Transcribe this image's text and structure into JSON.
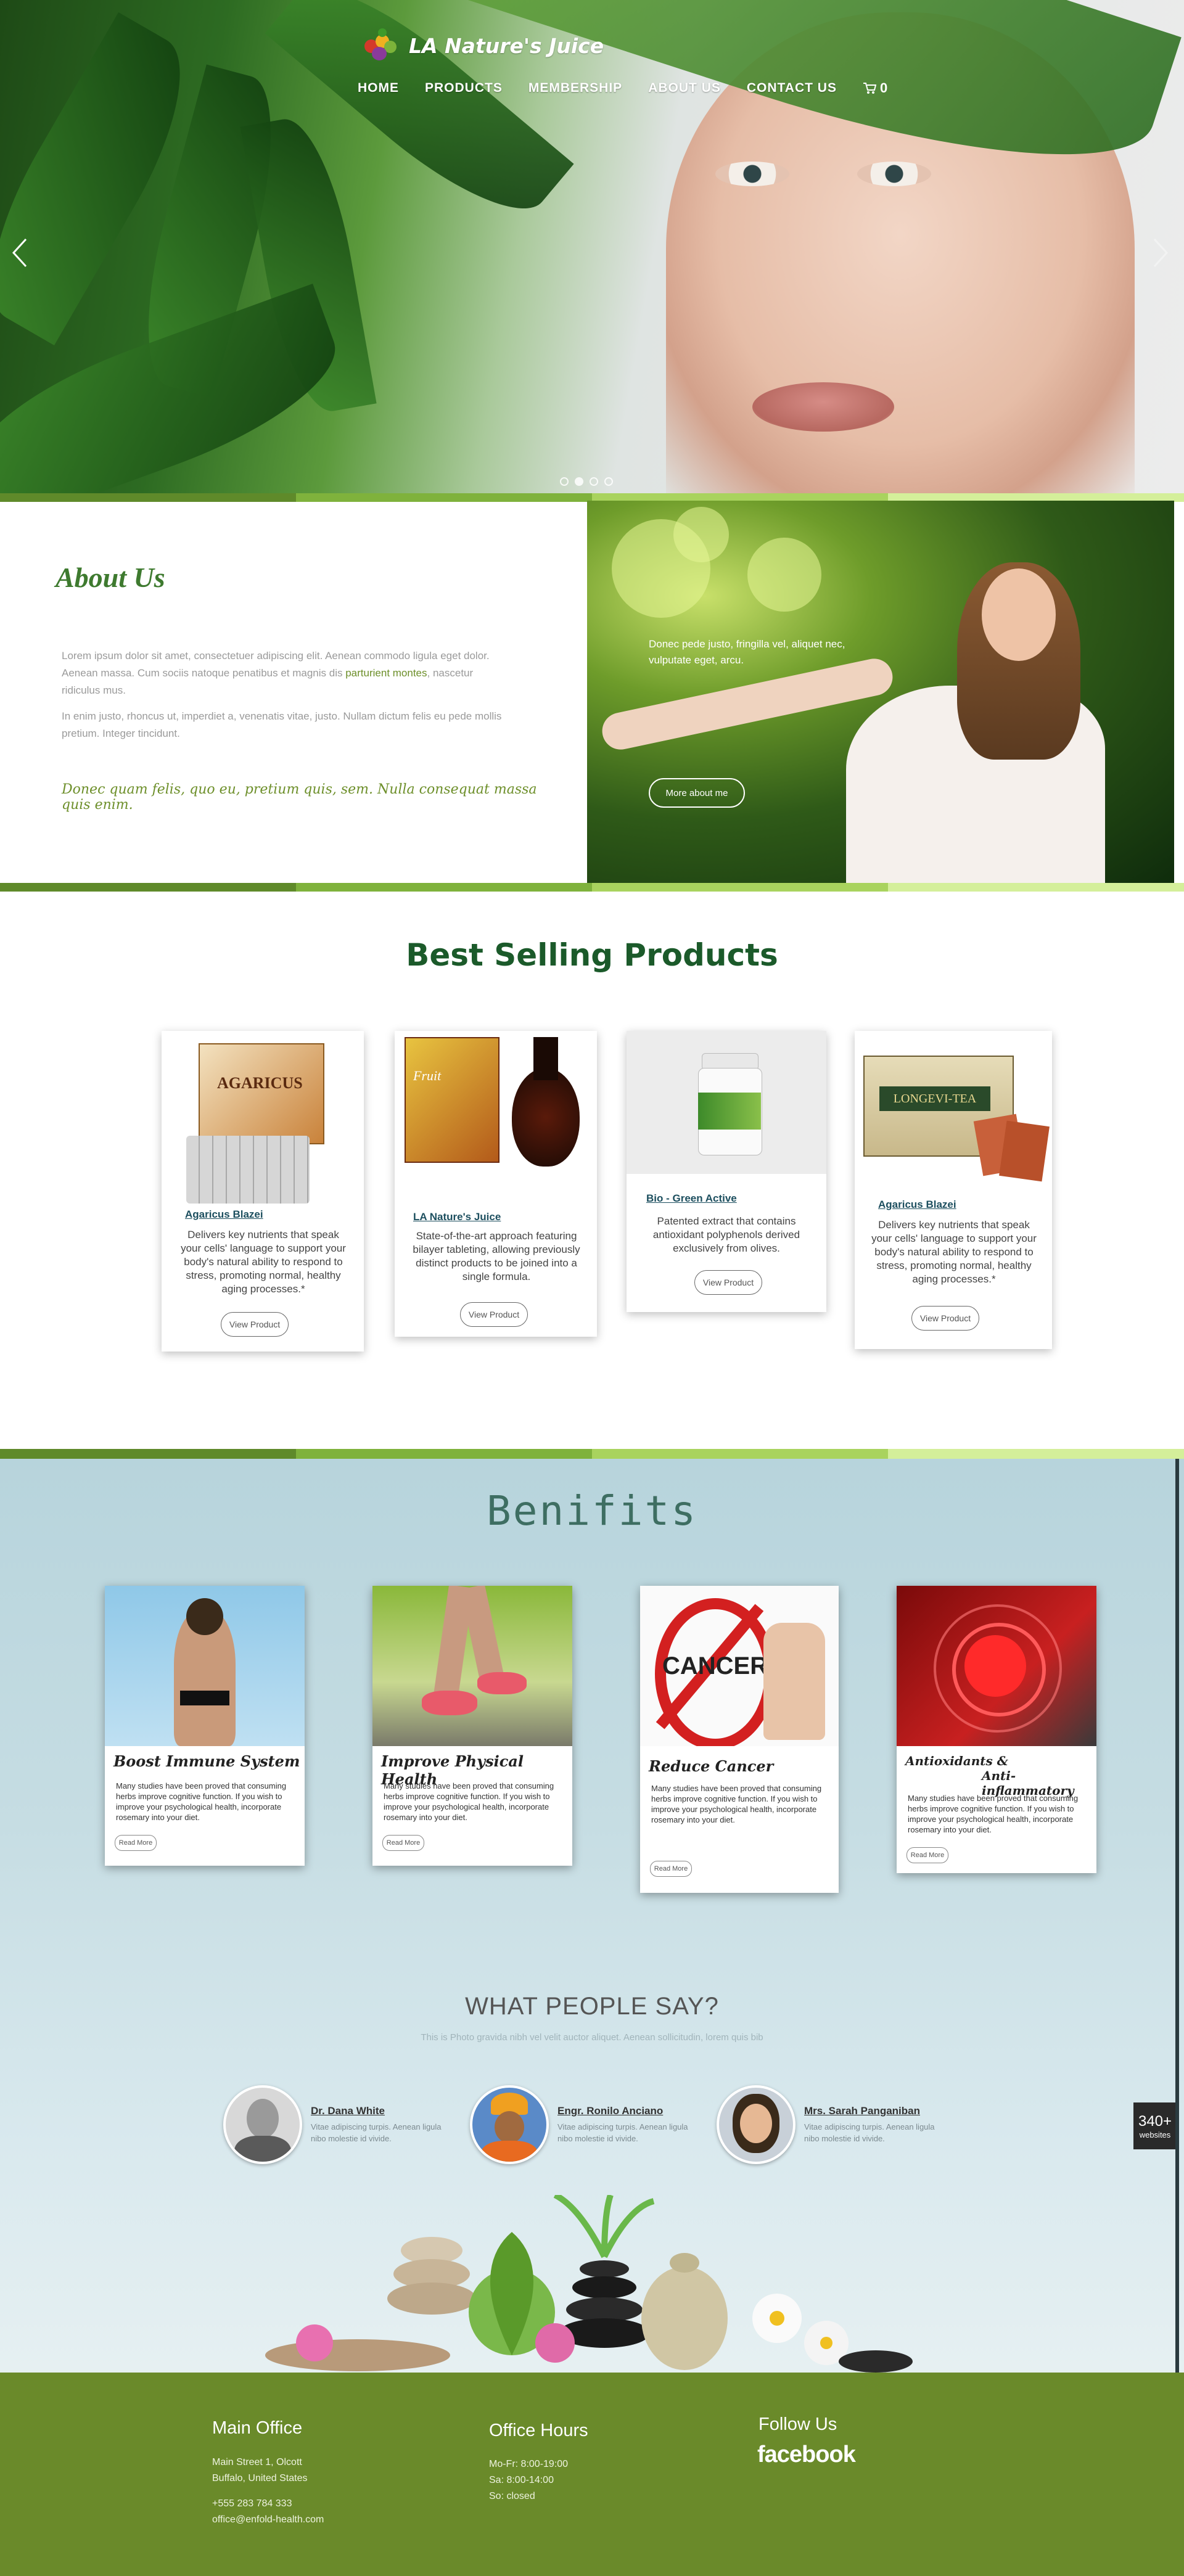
{
  "brand": {
    "name": "LA Nature's Juice"
  },
  "nav": {
    "items": [
      "HOME",
      "PRODUCTS",
      "MEMBERSHIP",
      "ABOUT US",
      "CONTACT US"
    ],
    "cart_count": "0"
  },
  "about": {
    "title": "About Us",
    "p1_before": "Lorem ipsum dolor sit amet, consectetuer adipiscing elit. Aenean commodo ligula eget dolor. Aenean massa. Cum sociis natoque penatibus et magnis dis ",
    "p1_highlight": "parturient montes",
    "p1_after": ", nascetur ridiculus mus.",
    "p2": "In enim justo, rhoncus ut, imperdiet a, venenatis vitae, justo. Nullam dictum felis eu pede mollis pretium. Integer tincidunt.",
    "quote": "Donec quam felis, quo eu, pretium quis, sem. Nulla consequat massa quis enim.",
    "photo_text": "Donec pede justo, fringilla vel, aliquet nec, vulputate eget, arcu.",
    "button": "More about me"
  },
  "products": {
    "title": "Best Selling Products",
    "items": [
      {
        "name": "Agaricus Blazei",
        "desc": "Delivers key nutrients that speak your cells' language to support your body's natural ability to respond to stress, promoting normal, healthy aging processes.*",
        "button": "View Product"
      },
      {
        "name": "LA Nature's Juice",
        "desc": "State-of-the-art approach featuring bilayer tableting, allowing previously distinct products to be joined into a single formula.",
        "button": "View Product"
      },
      {
        "name": "Bio - Green Active",
        "desc": "Patented extract that contains antioxidant polyphenols derived exclusively from olives.",
        "button": "View Product"
      },
      {
        "name": "Agaricus Blazei",
        "desc": "Delivers key nutrients that speak your cells' language to support your body's natural ability to respond to stress, promoting normal, healthy aging processes.*",
        "button": "View Product"
      }
    ]
  },
  "benefits": {
    "title": "Benifits",
    "items": [
      {
        "title": "Boost Immune System",
        "desc": "Many studies have been proved that consuming herbs improve cognitive function. If you wish to improve your psychological health, incorporate rosemary into your diet.",
        "button": "Read More"
      },
      {
        "title": "Improve Physical Health",
        "desc": "Many studies have been proved that consuming herbs improve cognitive function. If you wish to improve your psychological health, incorporate rosemary into your diet.",
        "button": "Read More"
      },
      {
        "title": "Reduce Cancer",
        "desc": "Many studies have been proved that consuming herbs improve cognitive function. If you wish to improve your psychological health, incorporate rosemary into your diet.",
        "button": "Read More"
      },
      {
        "title_line1": "Antioxidants &",
        "title_line2": "Anti-inflammatory",
        "desc": "Many studies have been proved that consuming herbs improve cognitive function. If you wish to improve your psychological health, incorporate rosemary into your diet.",
        "button": "Read More"
      }
    ],
    "cancer_word": "CANCER"
  },
  "testimonials": {
    "title": "WHAT PEOPLE SAY?",
    "subtitle": "This is Photo gravida nibh vel velit auctor aliquet. Aenean sollicitudin, lorem quis bib",
    "items": [
      {
        "name": "Dr. Dana White",
        "text": "Vitae adipiscing turpis. Aenean ligula nibo molestie id vivide."
      },
      {
        "name": "Engr. Ronilo Anciano",
        "text": "Vitae adipiscing turpis. Aenean ligula nibo molestie id vivide."
      },
      {
        "name": "Mrs. Sarah Panganiban",
        "text": "Vitae adipiscing turpis. Aenean ligula nibo molestie id vivide."
      }
    ]
  },
  "badge": {
    "number": "340+",
    "label": "websites"
  },
  "footer": {
    "office": {
      "title": "Main Office",
      "lines": [
        "Main Street 1, Olcott",
        "Buffalo, United States",
        "+555 283 784 333",
        "office@enfold-health.com"
      ]
    },
    "hours": {
      "title": "Office Hours",
      "lines": [
        "Mo-Fr: 8:00-19:00",
        "Sa: 8:00-14:00",
        "So: closed"
      ]
    },
    "follow": {
      "title": "Follow Us",
      "social": "facebook"
    }
  },
  "colors": {
    "brand_green": "#6a8a2a",
    "title_green": "#1b5a2a",
    "accent_green": "#6d8f2a",
    "stripe": [
      "#5f8a2a",
      "#7fb23c",
      "#a9d35e",
      "#d4ef9a"
    ]
  }
}
